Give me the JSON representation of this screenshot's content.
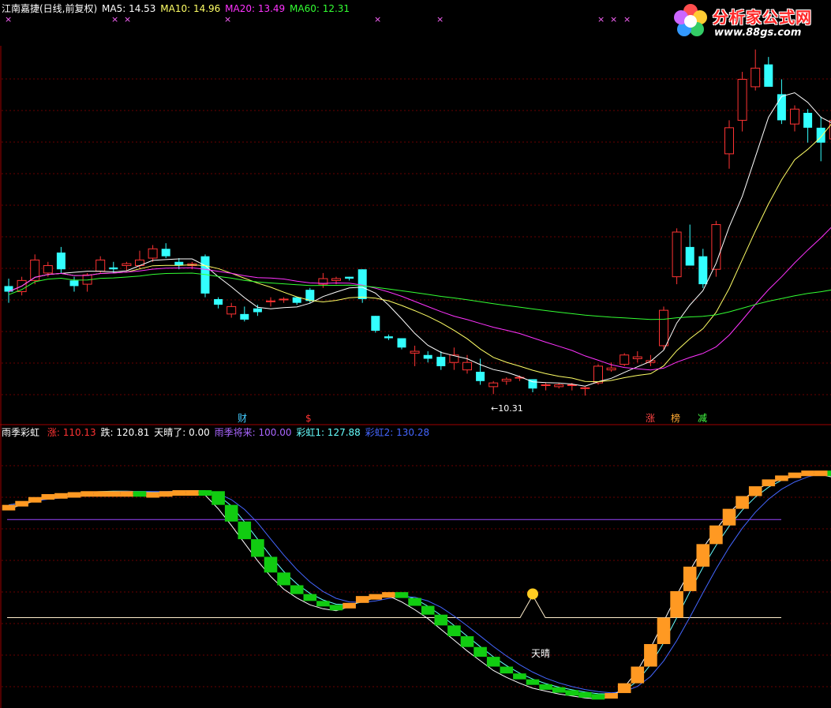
{
  "top_panel": {
    "name": "江南嘉捷(日线,前复权)",
    "ma": [
      {
        "label": "MA5: 14.53",
        "color": "#ffffff"
      },
      {
        "label": "MA10: 14.96",
        "color": "#ffff66"
      },
      {
        "label": "MA20: 13.49",
        "color": "#ff33ff"
      },
      {
        "label": "MA60: 12.31",
        "color": "#33ff33"
      }
    ],
    "low_label": "←10.31",
    "markers": [
      {
        "text": "财",
        "color": "#44ccff"
      },
      {
        "text": "$",
        "color": "#ff3333"
      },
      {
        "text": "涨",
        "color": "#ff4444"
      },
      {
        "text": "榜",
        "color": "#ffaa33"
      },
      {
        "text": "减",
        "color": "#44ff44"
      }
    ],
    "x_marks_text": "×"
  },
  "bottom_panel": {
    "name": "雨季彩虹",
    "values": [
      {
        "label": "涨: 110.13",
        "color": "#ff3333"
      },
      {
        "label": "跌: 120.81",
        "color": "#ffffff"
      },
      {
        "label": "天晴了: 0.00",
        "color": "#ffffff"
      },
      {
        "label": "雨季将来: 100.00",
        "color": "#aa66ff"
      },
      {
        "label": "彩虹1: 127.88",
        "color": "#66ffff"
      },
      {
        "label": "彩虹2: 130.28",
        "color": "#4466ff"
      }
    ],
    "sunny_label": "天晴"
  },
  "logo": {
    "title": "分析家公式网",
    "url": "www.88gs.com"
  },
  "chart_data": {
    "type": "candlestick",
    "price_candles": [
      [
        13.25,
        13.45,
        12.8,
        13.1
      ],
      [
        13.1,
        13.5,
        13.0,
        13.4
      ],
      [
        13.4,
        14.1,
        13.3,
        13.95
      ],
      [
        13.6,
        13.9,
        13.5,
        13.8
      ],
      [
        14.15,
        14.3,
        13.6,
        13.7
      ],
      [
        13.4,
        13.5,
        13.1,
        13.25
      ],
      [
        13.3,
        13.6,
        13.1,
        13.55
      ],
      [
        13.65,
        14.05,
        13.6,
        13.95
      ],
      [
        13.75,
        13.9,
        13.6,
        13.7
      ],
      [
        13.8,
        13.9,
        13.65,
        13.85
      ],
      [
        13.8,
        14.2,
        13.7,
        13.95
      ],
      [
        14.0,
        14.35,
        13.9,
        14.25
      ],
      [
        14.25,
        14.4,
        14.0,
        14.05
      ],
      [
        13.9,
        14.0,
        13.7,
        13.8
      ],
      [
        13.8,
        13.9,
        13.7,
        13.85
      ],
      [
        14.05,
        14.1,
        12.95,
        13.05
      ],
      [
        12.9,
        12.95,
        12.65,
        12.75
      ],
      [
        12.5,
        12.8,
        12.4,
        12.7
      ],
      [
        12.5,
        12.7,
        12.3,
        12.35
      ],
      [
        12.65,
        12.75,
        12.45,
        12.55
      ],
      [
        12.85,
        12.95,
        12.7,
        12.85
      ],
      [
        12.9,
        12.95,
        12.8,
        12.9
      ],
      [
        12.95,
        12.95,
        12.75,
        12.8
      ],
      [
        13.15,
        13.2,
        12.8,
        12.85
      ],
      [
        13.3,
        13.6,
        13.2,
        13.45
      ],
      [
        13.4,
        13.5,
        13.3,
        13.45
      ],
      [
        13.5,
        13.5,
        13.4,
        13.45
      ],
      [
        13.7,
        13.7,
        12.8,
        12.9
      ],
      [
        12.45,
        12.45,
        12.0,
        12.05
      ],
      [
        11.9,
        11.95,
        11.8,
        11.85
      ],
      [
        11.85,
        11.85,
        11.55,
        11.6
      ],
      [
        11.45,
        11.65,
        11.1,
        11.5
      ],
      [
        11.4,
        11.5,
        11.2,
        11.3
      ],
      [
        11.35,
        11.5,
        11.0,
        11.1
      ],
      [
        11.2,
        11.6,
        11.0,
        11.4
      ],
      [
        11.0,
        11.4,
        10.9,
        11.2
      ],
      [
        10.95,
        11.3,
        10.6,
        10.7
      ],
      [
        10.55,
        10.7,
        10.35,
        10.65
      ],
      [
        10.7,
        10.8,
        10.6,
        10.75
      ],
      [
        10.8,
        10.85,
        10.7,
        10.8
      ],
      [
        10.75,
        10.75,
        10.4,
        10.5
      ],
      [
        10.6,
        10.65,
        10.45,
        10.6
      ],
      [
        10.55,
        10.65,
        10.5,
        10.6
      ],
      [
        10.6,
        10.65,
        10.45,
        10.6
      ],
      [
        10.5,
        10.55,
        10.31,
        10.52
      ],
      [
        10.65,
        11.15,
        10.6,
        11.1
      ],
      [
        11.0,
        11.2,
        10.95,
        11.05
      ],
      [
        11.15,
        11.45,
        11.1,
        11.4
      ],
      [
        11.3,
        11.5,
        11.2,
        11.35
      ],
      [
        11.2,
        11.4,
        11.1,
        11.25
      ],
      [
        11.65,
        12.7,
        11.55,
        12.6
      ],
      [
        13.5,
        14.8,
        13.3,
        14.7
      ],
      [
        14.3,
        14.9,
        13.9,
        13.8
      ],
      [
        14.05,
        14.25,
        13.2,
        13.3
      ],
      [
        13.7,
        15.0,
        13.5,
        14.9
      ],
      [
        16.8,
        17.7,
        16.4,
        17.5
      ],
      [
        17.7,
        19.0,
        17.4,
        18.8
      ],
      [
        18.6,
        19.6,
        18.5,
        19.1
      ],
      [
        19.2,
        19.4,
        18.8,
        18.6
      ],
      [
        18.4,
        18.8,
        17.6,
        17.7
      ],
      [
        17.6,
        18.1,
        17.4,
        18.0
      ],
      [
        17.9,
        18.0,
        17.1,
        17.5
      ],
      [
        17.5,
        17.8,
        16.6,
        17.1
      ],
      [
        17.2,
        17.8,
        17.0,
        17.7
      ],
      [
        17.7,
        17.7,
        16.9,
        17.2
      ]
    ],
    "ma_series_names": [
      "MA5",
      "MA10",
      "MA20",
      "MA60"
    ],
    "low_point": 10.31,
    "indicator": {
      "rainy_level": 100.0,
      "sunny_level": 0.0,
      "rainbow_steps": [
        115,
        119,
        123,
        126,
        127,
        128,
        129,
        129,
        129,
        129,
        128,
        128,
        129,
        130,
        130,
        129,
        115,
        98,
        80,
        62,
        46,
        33,
        24,
        17,
        13,
        11,
        15,
        22,
        24,
        26,
        20,
        12,
        3,
        -8,
        -19,
        -30,
        -40,
        -50,
        -57,
        -63,
        -68,
        -71,
        -74,
        -76,
        -78,
        -79,
        -77,
        -67,
        -50,
        -27,
        0,
        27,
        52,
        75,
        94,
        111,
        124,
        134,
        141,
        145,
        148,
        150,
        150,
        147,
        142,
        136,
        128
      ]
    }
  }
}
